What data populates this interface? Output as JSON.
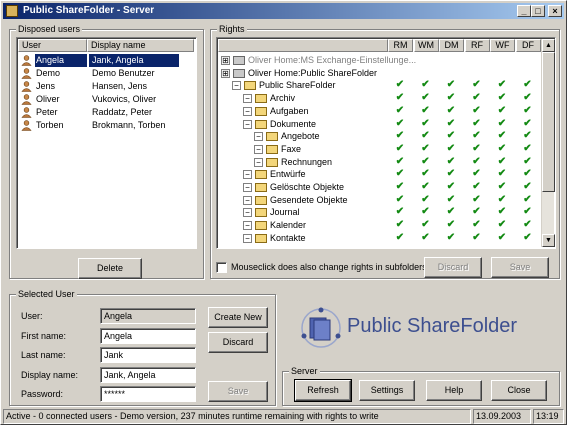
{
  "window": {
    "title": "Public ShareFolder - Server",
    "buttons": [
      "_",
      "□",
      "×"
    ]
  },
  "disposed_users": {
    "label": "Disposed users",
    "columns": [
      "User",
      "Display name"
    ],
    "rows": [
      {
        "user": "Angela",
        "display": "Jank, Angela",
        "selected": true
      },
      {
        "user": "Demo",
        "display": "Demo Benutzer"
      },
      {
        "user": "Jens",
        "display": "Hansen, Jens"
      },
      {
        "user": "Oliver",
        "display": "Vukovics, Oliver"
      },
      {
        "user": "Peter",
        "display": "Raddatz, Peter"
      },
      {
        "user": "Torben",
        "display": "Brokmann, Torben"
      }
    ],
    "delete_label": "Delete"
  },
  "rights": {
    "label": "Rights",
    "columns": [
      "RM",
      "WM",
      "DM",
      "RF",
      "WF",
      "DF"
    ],
    "tree": [
      {
        "label": "Oliver Home:MS Exchange-Einstellunge...",
        "level": 0,
        "type": "server",
        "grey": true,
        "checks": false
      },
      {
        "label": "Oliver Home:Public ShareFolder",
        "level": 0,
        "type": "server",
        "grey": false,
        "checks": false
      },
      {
        "label": "Public ShareFolder",
        "level": 1,
        "type": "folder",
        "checks": true
      },
      {
        "label": "Archiv",
        "level": 2,
        "type": "folder",
        "checks": true
      },
      {
        "label": "Aufgaben",
        "level": 2,
        "type": "folder",
        "checks": true
      },
      {
        "label": "Dokumente",
        "level": 2,
        "type": "folder",
        "checks": true
      },
      {
        "label": "Angebote",
        "level": 3,
        "type": "folder",
        "checks": true
      },
      {
        "label": "Faxe",
        "level": 3,
        "type": "folder",
        "checks": true
      },
      {
        "label": "Rechnungen",
        "level": 3,
        "type": "folder",
        "checks": true
      },
      {
        "label": "Entwürfe",
        "level": 2,
        "type": "folder",
        "checks": true
      },
      {
        "label": "Gelöschte Objekte",
        "level": 2,
        "type": "folder",
        "checks": true
      },
      {
        "label": "Gesendete Objekte",
        "level": 2,
        "type": "folder",
        "checks": true
      },
      {
        "label": "Journal",
        "level": 2,
        "type": "folder",
        "checks": true
      },
      {
        "label": "Kalender",
        "level": 2,
        "type": "folder",
        "checks": true
      },
      {
        "label": "Kontakte",
        "level": 2,
        "type": "folder",
        "checks": true
      }
    ],
    "subfolders_checkbox_label": "Mouseclick does also change rights in subfolders",
    "discard_label": "Discard",
    "save_label": "Save"
  },
  "selected_user": {
    "label": "Selected User",
    "user_label": "User:",
    "user_value": "Angela",
    "first_name_label": "First name:",
    "first_name_value": "Angela",
    "last_name_label": "Last name:",
    "last_name_value": "Jank",
    "display_name_label": "Display name:",
    "display_name_value": "Jank, Angela",
    "password_label": "Password:",
    "password_value": "******",
    "create_new_label": "Create New",
    "discard_label": "Discard",
    "save_label": "Save"
  },
  "brand": {
    "text": "Public ShareFolder",
    "color": "#3d4f8f"
  },
  "server": {
    "label": "Server",
    "refresh_label": "Refresh",
    "settings_label": "Settings",
    "help_label": "Help",
    "close_label": "Close"
  },
  "statusbar": {
    "message": "Active - 0 connected users - Demo version, 237 minutes runtime remaining with rights to write",
    "date": "13.09.2003",
    "time": "13:19"
  }
}
